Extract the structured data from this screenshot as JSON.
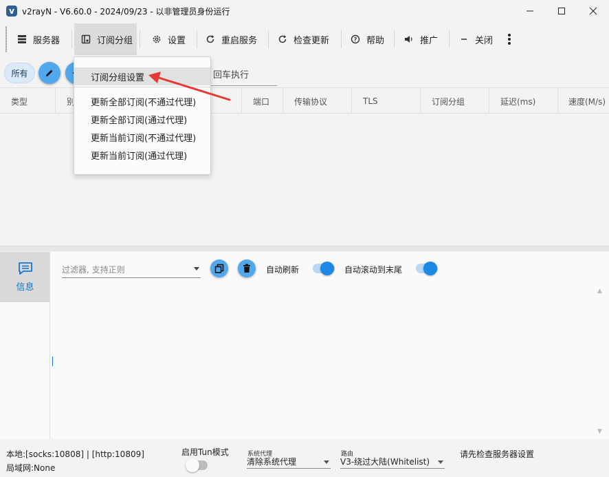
{
  "window": {
    "app_icon": "v",
    "title": "v2rayN - V6.60.0 - 2024/09/23 - 以非管理员身份运行"
  },
  "toolbar": {
    "servers": "服务器",
    "sub_group": "订阅分组",
    "settings": "设置",
    "restart": "重启服务",
    "check_update": "检查更新",
    "help": "帮助",
    "promote": "推广",
    "close": "关闭"
  },
  "filter": {
    "all_chip": "所有",
    "tail_text": "回车执行"
  },
  "table": {
    "columns": [
      "类型",
      "别",
      "端口",
      "传输协议",
      "TLS",
      "订阅分组",
      "延迟(ms)",
      "速度(M/s)"
    ]
  },
  "dropdown": {
    "items": [
      "订阅分组设置",
      "更新全部订阅(不通过代理)",
      "更新全部订阅(通过代理)",
      "更新当前订阅(不通过代理)",
      "更新当前订阅(通过代理)"
    ]
  },
  "log_panel": {
    "tab_label": "信息",
    "filter_placeholder": "过滤器, 支持正则",
    "auto_refresh": "自动刷新",
    "auto_scroll": "自动滚动到末尾",
    "auto_refresh_on": true,
    "auto_scroll_on": true
  },
  "statusbar": {
    "local": "本地:[socks:10808] | [http:10809]",
    "lan": "局域网:None",
    "tun_label": "启用Tun模式",
    "tun_on": false,
    "sysproxy_caption": "系统代理",
    "sysproxy_value": "清除系统代理",
    "routing_caption": "路由",
    "routing_value": "V3-绕过大陆(Whitelist)",
    "message": "请先检查服务器设置"
  },
  "colors": {
    "accent": "#1e88e5",
    "round_button": "#52a8ec",
    "annotation_arrow": "#e53935"
  }
}
